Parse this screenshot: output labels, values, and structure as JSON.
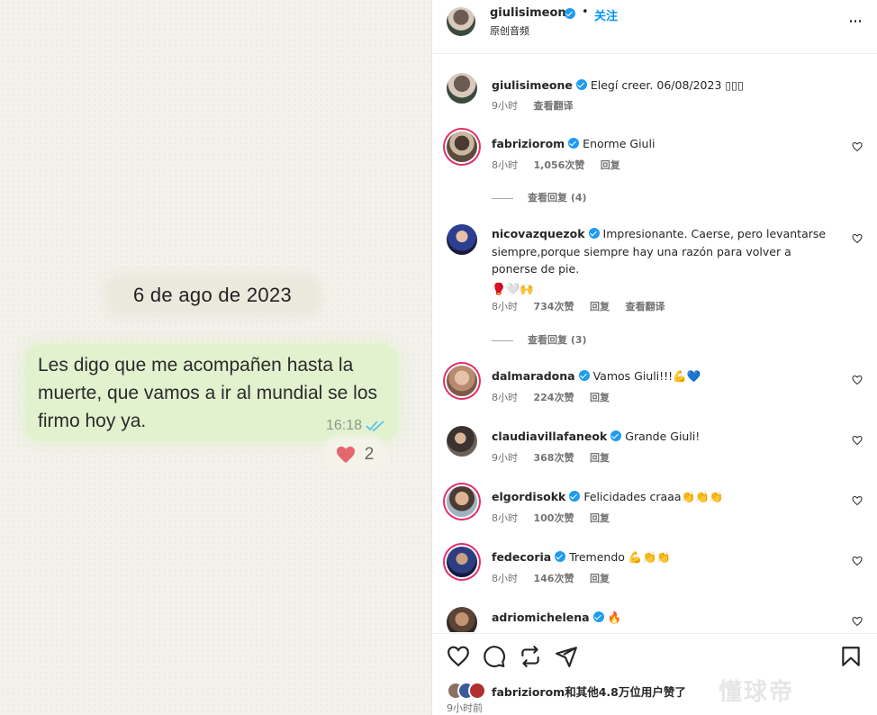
{
  "media": {
    "date_pill": "6 de ago de 2023",
    "bubble_text": "Les digo que me acompañen hasta la muerte, que vamos a ir al mundial se los firmo hoy ya.",
    "bubble_time": "16:18",
    "reaction_count": "2"
  },
  "header": {
    "username": "giulisimeone",
    "separator": "•",
    "follow_label": "关注",
    "subtitle": "原创音频"
  },
  "caption": {
    "username": "giulisimeone",
    "text": "Elegí creer. 06/08/2023 ▯▯▯",
    "time": "9小时",
    "translate": "查看翻译"
  },
  "comments": [
    {
      "username": "fabriziorom",
      "text": "Enorme Giuli",
      "time": "8小时",
      "likes": "1,056次赞",
      "reply": "回复",
      "view_replies": "查看回复 (4)"
    },
    {
      "username": "nicovazquezok",
      "text": "Impresionante. Caerse, pero levantarse siempre,porque siempre hay una razón para volver a ponerse de pie.",
      "emoji": "🥊🤍🙌",
      "time": "8小时",
      "likes": "734次赞",
      "reply": "回复",
      "translate": "查看翻译",
      "view_replies": "查看回复 (3)"
    },
    {
      "username": "dalmaradona",
      "text": "Vamos Giuli!!!💪💙",
      "time": "8小时",
      "likes": "224次赞",
      "reply": "回复"
    },
    {
      "username": "claudiavillafaneok",
      "text": "Grande Giuli!",
      "time": "9小时",
      "likes": "368次赞",
      "reply": "回复"
    },
    {
      "username": "elgordisokk",
      "text": "Felicidades craaa👏👏👏",
      "time": "8小时",
      "likes": "100次赞",
      "reply": "回复"
    },
    {
      "username": "fedecoria",
      "text": "Tremendo 💪👏👏",
      "time": "8小时",
      "likes": "146次赞",
      "reply": "回复"
    },
    {
      "username": "adriomichelena",
      "text": "🔥"
    }
  ],
  "footer": {
    "liked_by_user": "fabriziorom",
    "liked_by_rest": "和其他4.8万位用户赞了",
    "time_ago": "9小时前",
    "watermark": "懂球帝"
  },
  "colors": {
    "accent": "#0095f6",
    "verified": "#1d9bf0",
    "bubble": "#e2f2cf",
    "story_ring": "#e1306c"
  },
  "icons": [
    "heart-icon",
    "comment-icon",
    "share-icon",
    "send-icon",
    "bookmark-icon",
    "more-icon",
    "verified-icon",
    "double-check-icon"
  ]
}
